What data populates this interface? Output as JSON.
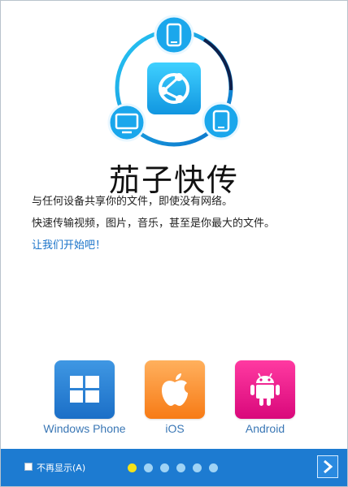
{
  "app": {
    "name": "茄子快传",
    "description_line1": "与任何设备共享你的文件，即使没有网络。",
    "description_line2": "快速传输视频，图片，音乐，甚至是你最大的文件。",
    "start_link": "让我们开始吧！"
  },
  "platforms": [
    {
      "label": "Windows Phone",
      "icon": "windows-logo-icon",
      "color": "#2a84d8"
    },
    {
      "label": "iOS",
      "icon": "apple-logo-icon",
      "color": "#f98b23"
    },
    {
      "label": "Android",
      "icon": "android-robot-icon",
      "color": "#e6148a"
    }
  ],
  "footer": {
    "dont_show_label": "不再显示(A)",
    "page_dots": 6,
    "active_dot": 0,
    "next_icon": "chevron-right-icon"
  },
  "colors": {
    "accent": "#1d7bd1",
    "logo_blue": "#1aa7ec",
    "link": "#1a73c9",
    "active_dot": "#f3e21a"
  }
}
